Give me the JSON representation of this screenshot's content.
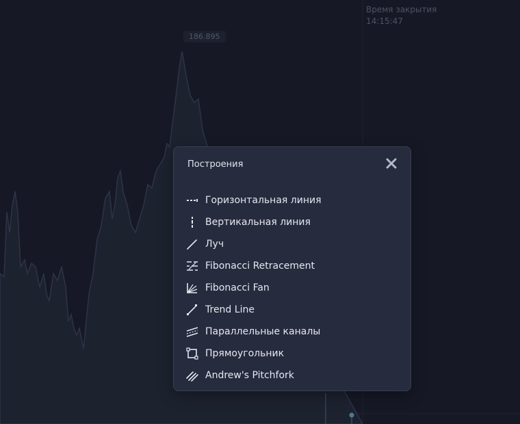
{
  "chart": {
    "price_label": "186.895",
    "close_time_label": "Время закрытия",
    "close_time_value": "14:15:47",
    "line_color": "#2d3447",
    "background": "#161925"
  },
  "modal": {
    "title": "Построения",
    "close_icon": "close-icon",
    "tools": [
      {
        "label": "Горизонтальная линия",
        "icon": "horizontal-line-icon"
      },
      {
        "label": "Вертикальная линия",
        "icon": "vertical-line-icon"
      },
      {
        "label": "Луч",
        "icon": "ray-icon"
      },
      {
        "label": "Fibonacci Retracement",
        "icon": "fibonacci-retracement-icon"
      },
      {
        "label": "Fibonacci Fan",
        "icon": "fibonacci-fan-icon"
      },
      {
        "label": "Trend Line",
        "icon": "trend-line-icon"
      },
      {
        "label": "Параллельные каналы",
        "icon": "parallel-channel-icon"
      },
      {
        "label": "Прямоугольник",
        "icon": "rectangle-icon"
      },
      {
        "label": "Andrew's Pitchfork",
        "icon": "pitchfork-icon"
      }
    ]
  }
}
